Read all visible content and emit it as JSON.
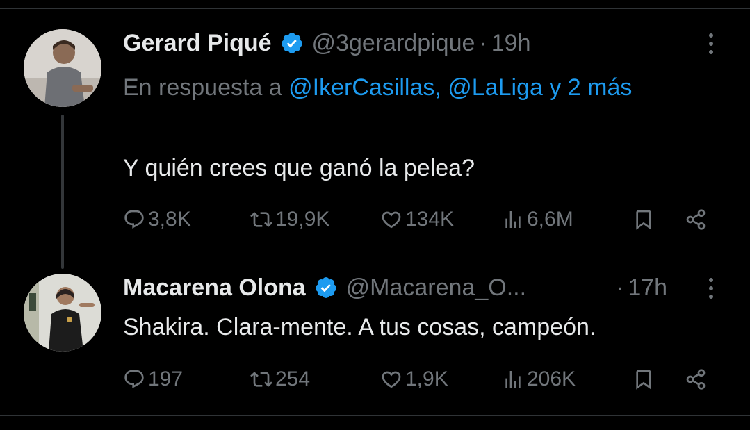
{
  "tweets": [
    {
      "name": "Gerard Piqué",
      "handle": "@3gerardpique",
      "separator": "·",
      "time": "19h",
      "reply_prefix": "En respuesta a",
      "reply_mentions": "@IkerCasillas, @LaLiga",
      "reply_more": "y 2 más",
      "text": "Y quién crees que ganó la pelea?",
      "replies": "3,8K",
      "retweets": "19,9K",
      "likes": "134K",
      "views": "6,6M"
    },
    {
      "name": "Macarena Olona",
      "handle": "@Macarena_O...",
      "separator": "·",
      "time": "17h",
      "text": "Shakira. Clara-mente. A tus cosas, campeón.",
      "replies": "197",
      "retweets": "254",
      "likes": "1,9K",
      "views": "206K"
    }
  ],
  "colors": {
    "background": "#000000",
    "text": "#e7e9ea",
    "muted": "#71767b",
    "link": "#1d9bf0",
    "verified": "#1d9bf0"
  },
  "icons": [
    "reply-icon",
    "retweet-icon",
    "like-icon",
    "views-icon",
    "bookmark-icon",
    "share-icon",
    "more-icon",
    "verified-badge-icon"
  ]
}
